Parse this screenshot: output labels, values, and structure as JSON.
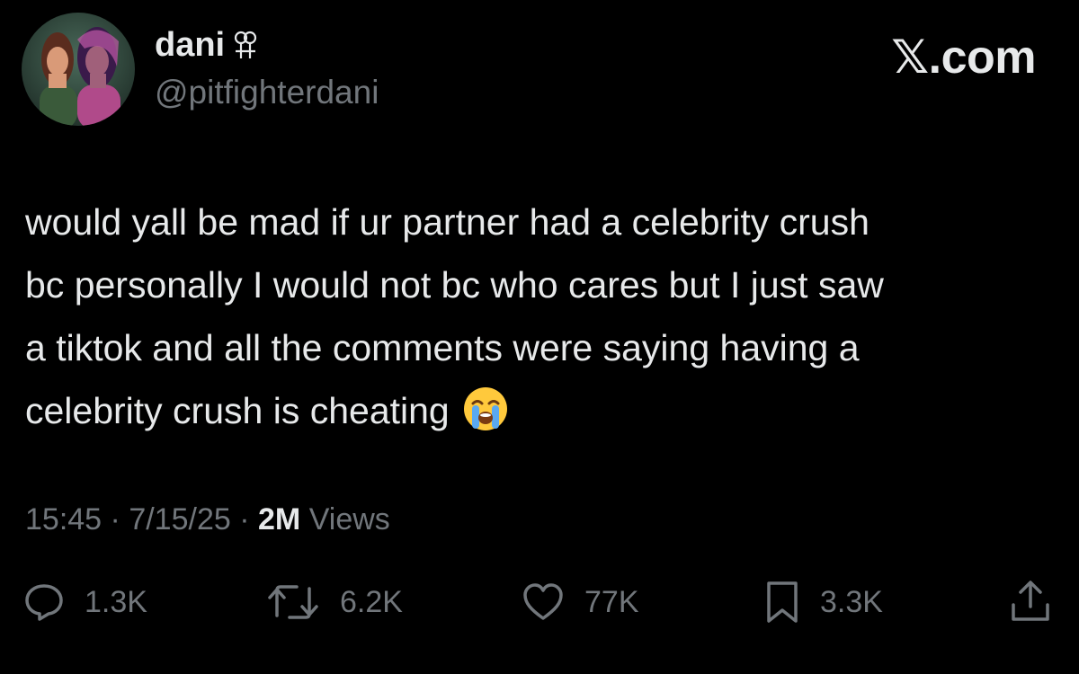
{
  "user": {
    "display_name": "dani",
    "name_symbol": "double-female-symbol",
    "handle": "@pitfighterdani",
    "avatar": "two-women-portrait"
  },
  "watermark": "𝕏.com",
  "tweet": {
    "lines": [
      "would yall be mad if ur partner had a celebrity crush",
      "bc personally I would not bc who cares but I just saw",
      "a tiktok and all the comments were saying having a",
      "celebrity crush is cheating"
    ],
    "emoji": "loudly-crying-face"
  },
  "meta": {
    "time": "15:45",
    "date": "7/15/25",
    "separator": "·",
    "views_count": "2M",
    "views_label": "Views"
  },
  "actions": {
    "replies": "1.3K",
    "reposts": "6.2K",
    "likes": "77K",
    "bookmarks": "3.3K"
  },
  "colors": {
    "background": "#000000",
    "text": "#e7e9ea",
    "secondary": "#71767b"
  }
}
